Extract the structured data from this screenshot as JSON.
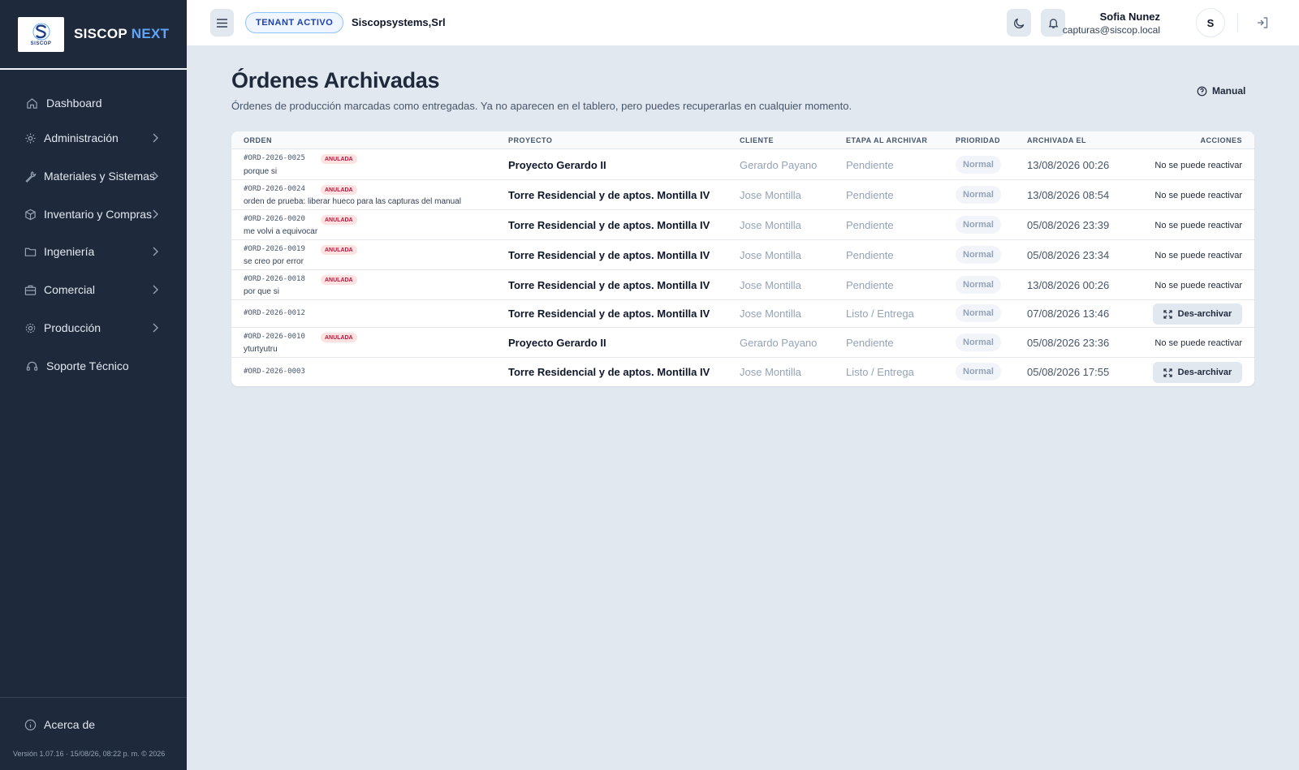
{
  "brand": {
    "logo_text": "SISCOP",
    "name_main": "SISCOP",
    "name_accent": "NEXT"
  },
  "sidebar": {
    "items": [
      {
        "label": "Dashboard",
        "icon": "home-icon",
        "has_chevron": false
      },
      {
        "label": "Administración",
        "icon": "gear-icon",
        "has_chevron": true
      },
      {
        "label": "Materiales y Sistemas",
        "icon": "wrench-icon",
        "has_chevron": true
      },
      {
        "label": "Inventario y Compras",
        "icon": "box-icon",
        "has_chevron": true
      },
      {
        "label": "Ingeniería",
        "icon": "folder-icon",
        "has_chevron": true
      },
      {
        "label": "Comercial",
        "icon": "briefcase-icon",
        "has_chevron": true
      },
      {
        "label": "Producción",
        "icon": "cog-icon",
        "has_chevron": true
      },
      {
        "label": "Soporte Técnico",
        "icon": "headset-icon",
        "has_chevron": false
      }
    ],
    "about_label": "Acerca de",
    "version": "Versión 1.07.16 · 15/08/26, 08:22 p. m. © 2026"
  },
  "header": {
    "tenant_badge": "TENANT ACTIVO",
    "tenant_name": "Siscopsystems,Srl",
    "user_name": "Sofia Nunez",
    "user_email": "capturas@siscop.local",
    "avatar_initial": "S"
  },
  "page": {
    "title": "Órdenes Archivadas",
    "subtitle": "Órdenes de producción marcadas como entregadas. Ya no aparecen en el tablero, pero puedes recuperarlas en cualquier momento.",
    "manual_label": "Manual"
  },
  "table": {
    "columns": [
      "ORDEN",
      "PROYECTO",
      "CLIENTE",
      "ETAPA AL ARCHIVAR",
      "PRIORIDAD",
      "ARCHIVADA EL",
      "ACCIONES"
    ],
    "rows": [
      {
        "code": "#ORD-2026-0025",
        "badge": "ANULADA",
        "note": "porque si",
        "project": "Proyecto Gerardo II",
        "client": "Gerardo Payano",
        "stage": "Pendiente",
        "priority": "Normal",
        "archived": "13/08/2026 00:26",
        "action": "No se puede reactivar"
      },
      {
        "code": "#ORD-2026-0024",
        "badge": "ANULADA",
        "note": "orden de prueba: liberar hueco para las capturas del manual",
        "project": "Torre Residencial y de aptos. Montilla IV",
        "client": "Jose Montilla",
        "stage": "Pendiente",
        "priority": "Normal",
        "archived": "13/08/2026 08:54",
        "action": "No se puede reactivar"
      },
      {
        "code": "#ORD-2026-0020",
        "badge": "ANULADA",
        "note": "me volvi a equivocar",
        "project": "Torre Residencial y de aptos. Montilla IV",
        "client": "Jose Montilla",
        "stage": "Pendiente",
        "priority": "Normal",
        "archived": "05/08/2026 23:39",
        "action": "No se puede reactivar"
      },
      {
        "code": "#ORD-2026-0019",
        "badge": "ANULADA",
        "note": "se creo por error",
        "project": "Torre Residencial y de aptos. Montilla IV",
        "client": "Jose Montilla",
        "stage": "Pendiente",
        "priority": "Normal",
        "archived": "05/08/2026 23:34",
        "action": "No se puede reactivar"
      },
      {
        "code": "#ORD-2026-0018",
        "badge": "ANULADA",
        "note": "por que si",
        "project": "Torre Residencial y de aptos. Montilla IV",
        "client": "Jose Montilla",
        "stage": "Pendiente",
        "priority": "Normal",
        "archived": "13/08/2026 00:26",
        "action": "No se puede reactivar"
      },
      {
        "code": "#ORD-2026-0012",
        "badge": "",
        "note": "",
        "project": "Torre Residencial y de aptos. Montilla IV",
        "client": "Jose Montilla",
        "stage": "Listo / Entrega",
        "priority": "Normal",
        "archived": "07/08/2026 13:46",
        "action": "Des-archivar"
      },
      {
        "code": "#ORD-2026-0010",
        "badge": "ANULADA",
        "note": "yturtyutru",
        "project": "Proyecto Gerardo II",
        "client": "Gerardo Payano",
        "stage": "Pendiente",
        "priority": "Normal",
        "archived": "05/08/2026 23:36",
        "action": "No se puede reactivar"
      },
      {
        "code": "#ORD-2026-0003",
        "badge": "",
        "note": "",
        "project": "Torre Residencial y de aptos. Montilla IV",
        "client": "Jose Montilla",
        "stage": "Listo / Entrega",
        "priority": "Normal",
        "archived": "05/08/2026 17:55",
        "action": "Des-archivar"
      }
    ]
  },
  "colors": {
    "sidebar_bg": "#1e293b",
    "accent": "#60a5fa",
    "page_bg": "#e2e8f0",
    "badge_red": "#be123c"
  }
}
